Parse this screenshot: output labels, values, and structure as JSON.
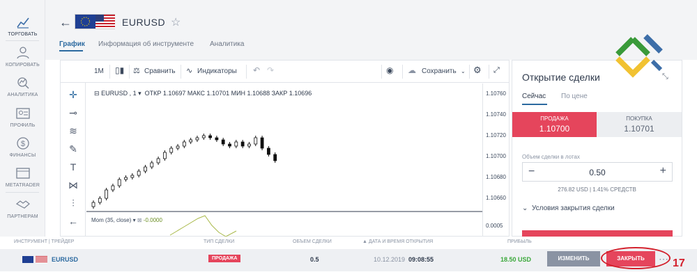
{
  "sidebar": {
    "items": [
      {
        "label": "ТОРГОВАТЬ",
        "icon": "chart-icon"
      },
      {
        "label": "КОПИРОВАТЬ",
        "icon": "users-icon"
      },
      {
        "label": "АНАЛИТИКА",
        "icon": "analytics-icon"
      },
      {
        "label": "ПРОФИЛЬ",
        "icon": "profile-card-icon"
      },
      {
        "label": "ФИНАНСЫ",
        "icon": "dollar-icon"
      },
      {
        "label": "METATRADER",
        "icon": "window-icon"
      },
      {
        "label": "ПАРТНЕРАМ",
        "icon": "handshake-icon"
      }
    ]
  },
  "header": {
    "back_icon": "←",
    "pair": "EURUSD",
    "star_icon": "☆",
    "tabs": [
      "График",
      "Информация об инструменте",
      "Аналитика"
    ]
  },
  "toolbar": {
    "timeframe": "1M",
    "compare": "Сравнить",
    "indicators": "Индикаторы",
    "undo": "↶",
    "redo": "↷",
    "save": "Сохранить"
  },
  "chart_data": {
    "type": "candlestick",
    "symbol_label": "EURUSD , 1",
    "ohlc_text": "ОТКР 1.10697  МАКС 1.10701  МИН 1.10688  ЗАКР 1.10696",
    "y_ticks": [
      "1.10760",
      "1.10740",
      "1.10720",
      "1.10700",
      "1.10680",
      "1.10660"
    ],
    "ylim": [
      1.1065,
      1.1077
    ],
    "close_series": [
      1.10656,
      1.1066,
      1.10668,
      1.10672,
      1.10678,
      1.1068,
      1.10682,
      1.10686,
      1.1069,
      1.10694,
      1.10698,
      1.10704,
      1.10708,
      1.1071,
      1.10714,
      1.10716,
      1.10718,
      1.1072,
      1.10718,
      1.10716,
      1.10712,
      1.1071,
      1.10714,
      1.1071,
      1.10712,
      1.10718,
      1.10708,
      1.10702,
      1.10696
    ],
    "indicator": {
      "label": "Mom (35, close)",
      "value": "-0.0000",
      "tick": "0.0005"
    }
  },
  "panel": {
    "title": "Открытие сделки",
    "tabs": [
      "Сейчас",
      "По цене"
    ],
    "sell_label": "ПРОДАЖА",
    "sell_price": "1.10700",
    "buy_label": "ПОКУПКА",
    "buy_price": "1.10701",
    "volume_label": "Объем сделки в лотах",
    "volume": "0.50",
    "funds": "276.82 USD  |  1.41% СРЕДСТВ",
    "conditions": "Условия закрытия сделки"
  },
  "positions": {
    "headers": [
      "ИНСТРУМЕНТ | ТРЕЙДЕР",
      "ТИП СДЕЛКИ",
      "ОБЪЕМ СДЕЛКИ",
      "▲ ДАТА И ВРЕМЯ ОТКРЫТИЯ",
      "ПРИБЫЛЬ"
    ],
    "row": {
      "instrument": "EURUSD",
      "type": "ПРОДАЖА",
      "volume": "0.5",
      "date": "10.12.2019",
      "time": "09:08:55",
      "profit": "18.50 USD",
      "edit": "ИЗМЕНИТЬ",
      "close": "ЗАКРЫТЬ"
    }
  },
  "annotation": {
    "number": "17"
  },
  "colors": {
    "sell": "#e5455c",
    "accent": "#2c6aa0",
    "profit": "#3aa83a",
    "annotation": "#d3202c"
  }
}
